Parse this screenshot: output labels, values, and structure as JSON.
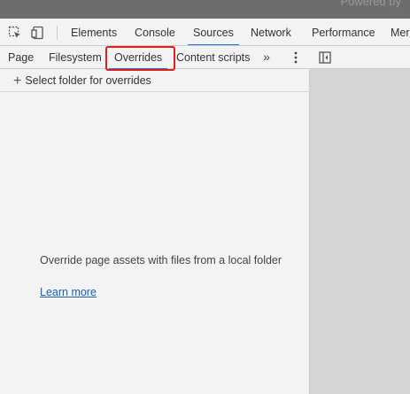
{
  "top": {
    "powered_text": "Powered by"
  },
  "devtools_tabs": [
    {
      "label": "Elements"
    },
    {
      "label": "Console"
    },
    {
      "label": "Sources"
    },
    {
      "label": "Network"
    },
    {
      "label": "Performance"
    },
    {
      "label": "Mer"
    }
  ],
  "active_tab": "Sources",
  "sources": {
    "subtabs": [
      {
        "label": "Page"
      },
      {
        "label": "Filesystem"
      },
      {
        "label": "Overrides"
      },
      {
        "label": "Content scripts"
      }
    ],
    "active_subtab": "Overrides",
    "more_tabs_glyph": "»",
    "select_folder_label": "Select folder for overrides",
    "empty_message": "Override page assets with files from a local folder",
    "learn_more_label": "Learn more"
  },
  "colors": {
    "accent": "#1a73e8",
    "highlight": "#e0201b",
    "link": "#1a5fb4"
  },
  "icons": [
    "inspect-element-icon",
    "device-toolbar-icon",
    "more-tabs-icon",
    "kebab-menu-icon",
    "plus-icon",
    "toggle-navigator-icon"
  ]
}
